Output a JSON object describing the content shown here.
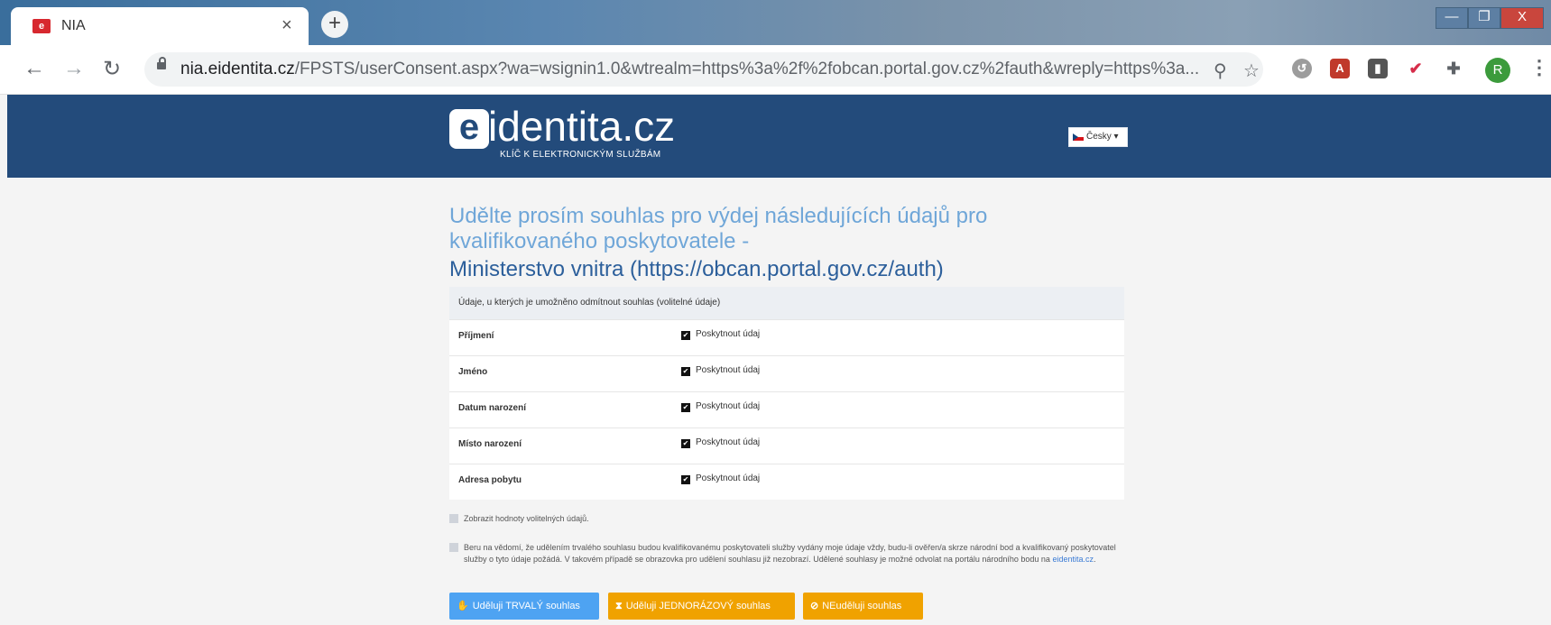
{
  "browser": {
    "tab_title": "NIA",
    "tab_close": "×",
    "new_tab": "+",
    "url_host": "nia.eidentita.cz",
    "url_rest": "/FPSTS/userConsent.aspx?wa=wsignin1.0&wtrealm=https%3a%2f%2fobcan.portal.gov.cz%2fauth&wreply=https%3a...",
    "avatar_letter": "R",
    "window_min": "—",
    "window_max": "❐",
    "window_close": "X"
  },
  "header": {
    "logo_main": "identita.cz",
    "logo_sub": "KLÍČ K ELEKTRONICKÝM SLUŽBÁM",
    "language": "Česky ▾"
  },
  "main": {
    "heading": "Udělte prosím souhlas pro výdej následujících údajů pro kvalifikovaného poskytovatele -",
    "provider": "Ministerstvo vnitra (https://obcan.portal.gov.cz/auth)",
    "table_header": "Údaje, u kterých je umožněno odmítnout souhlas (volitelné údaje)",
    "rows": [
      {
        "label": "Příjmení",
        "checkbox": "Poskytnout údaj"
      },
      {
        "label": "Jméno",
        "checkbox": "Poskytnout údaj"
      },
      {
        "label": "Datum narození",
        "checkbox": "Poskytnout údaj"
      },
      {
        "label": "Místo narození",
        "checkbox": "Poskytnout údaj"
      },
      {
        "label": "Adresa pobytu",
        "checkbox": "Poskytnout údaj"
      }
    ],
    "show_values": "Zobrazit hodnoty volitelných údajů.",
    "consent_text": "Beru na vědomí, že udělením trvalého souhlasu budou kvalifikovanému poskytovateli služby vydány moje údaje vždy, budu-li ověřen/a skrze národní bod a kvalifikovaný poskytovatel služby o tyto údaje požádá. V takovém případě se obrazovka pro udělení souhlasu již nezobrazí. Udělené souhlasy je možné odvolat na portálu národního bodu na",
    "consent_link": "eidentita.cz",
    "consent_end": "."
  },
  "buttons": {
    "permanent": "Uděluji TRVALÝ souhlas",
    "single": "Uděluji JEDNORÁZOVÝ souhlas",
    "deny": "NEuděluji souhlas"
  },
  "colors": {
    "header_bg": "#234b7b",
    "heading_light": "#6fa6d8",
    "heading_dark": "#2c5f9b",
    "btn_blue": "#4ea3f2",
    "btn_orange": "#f0a200"
  }
}
